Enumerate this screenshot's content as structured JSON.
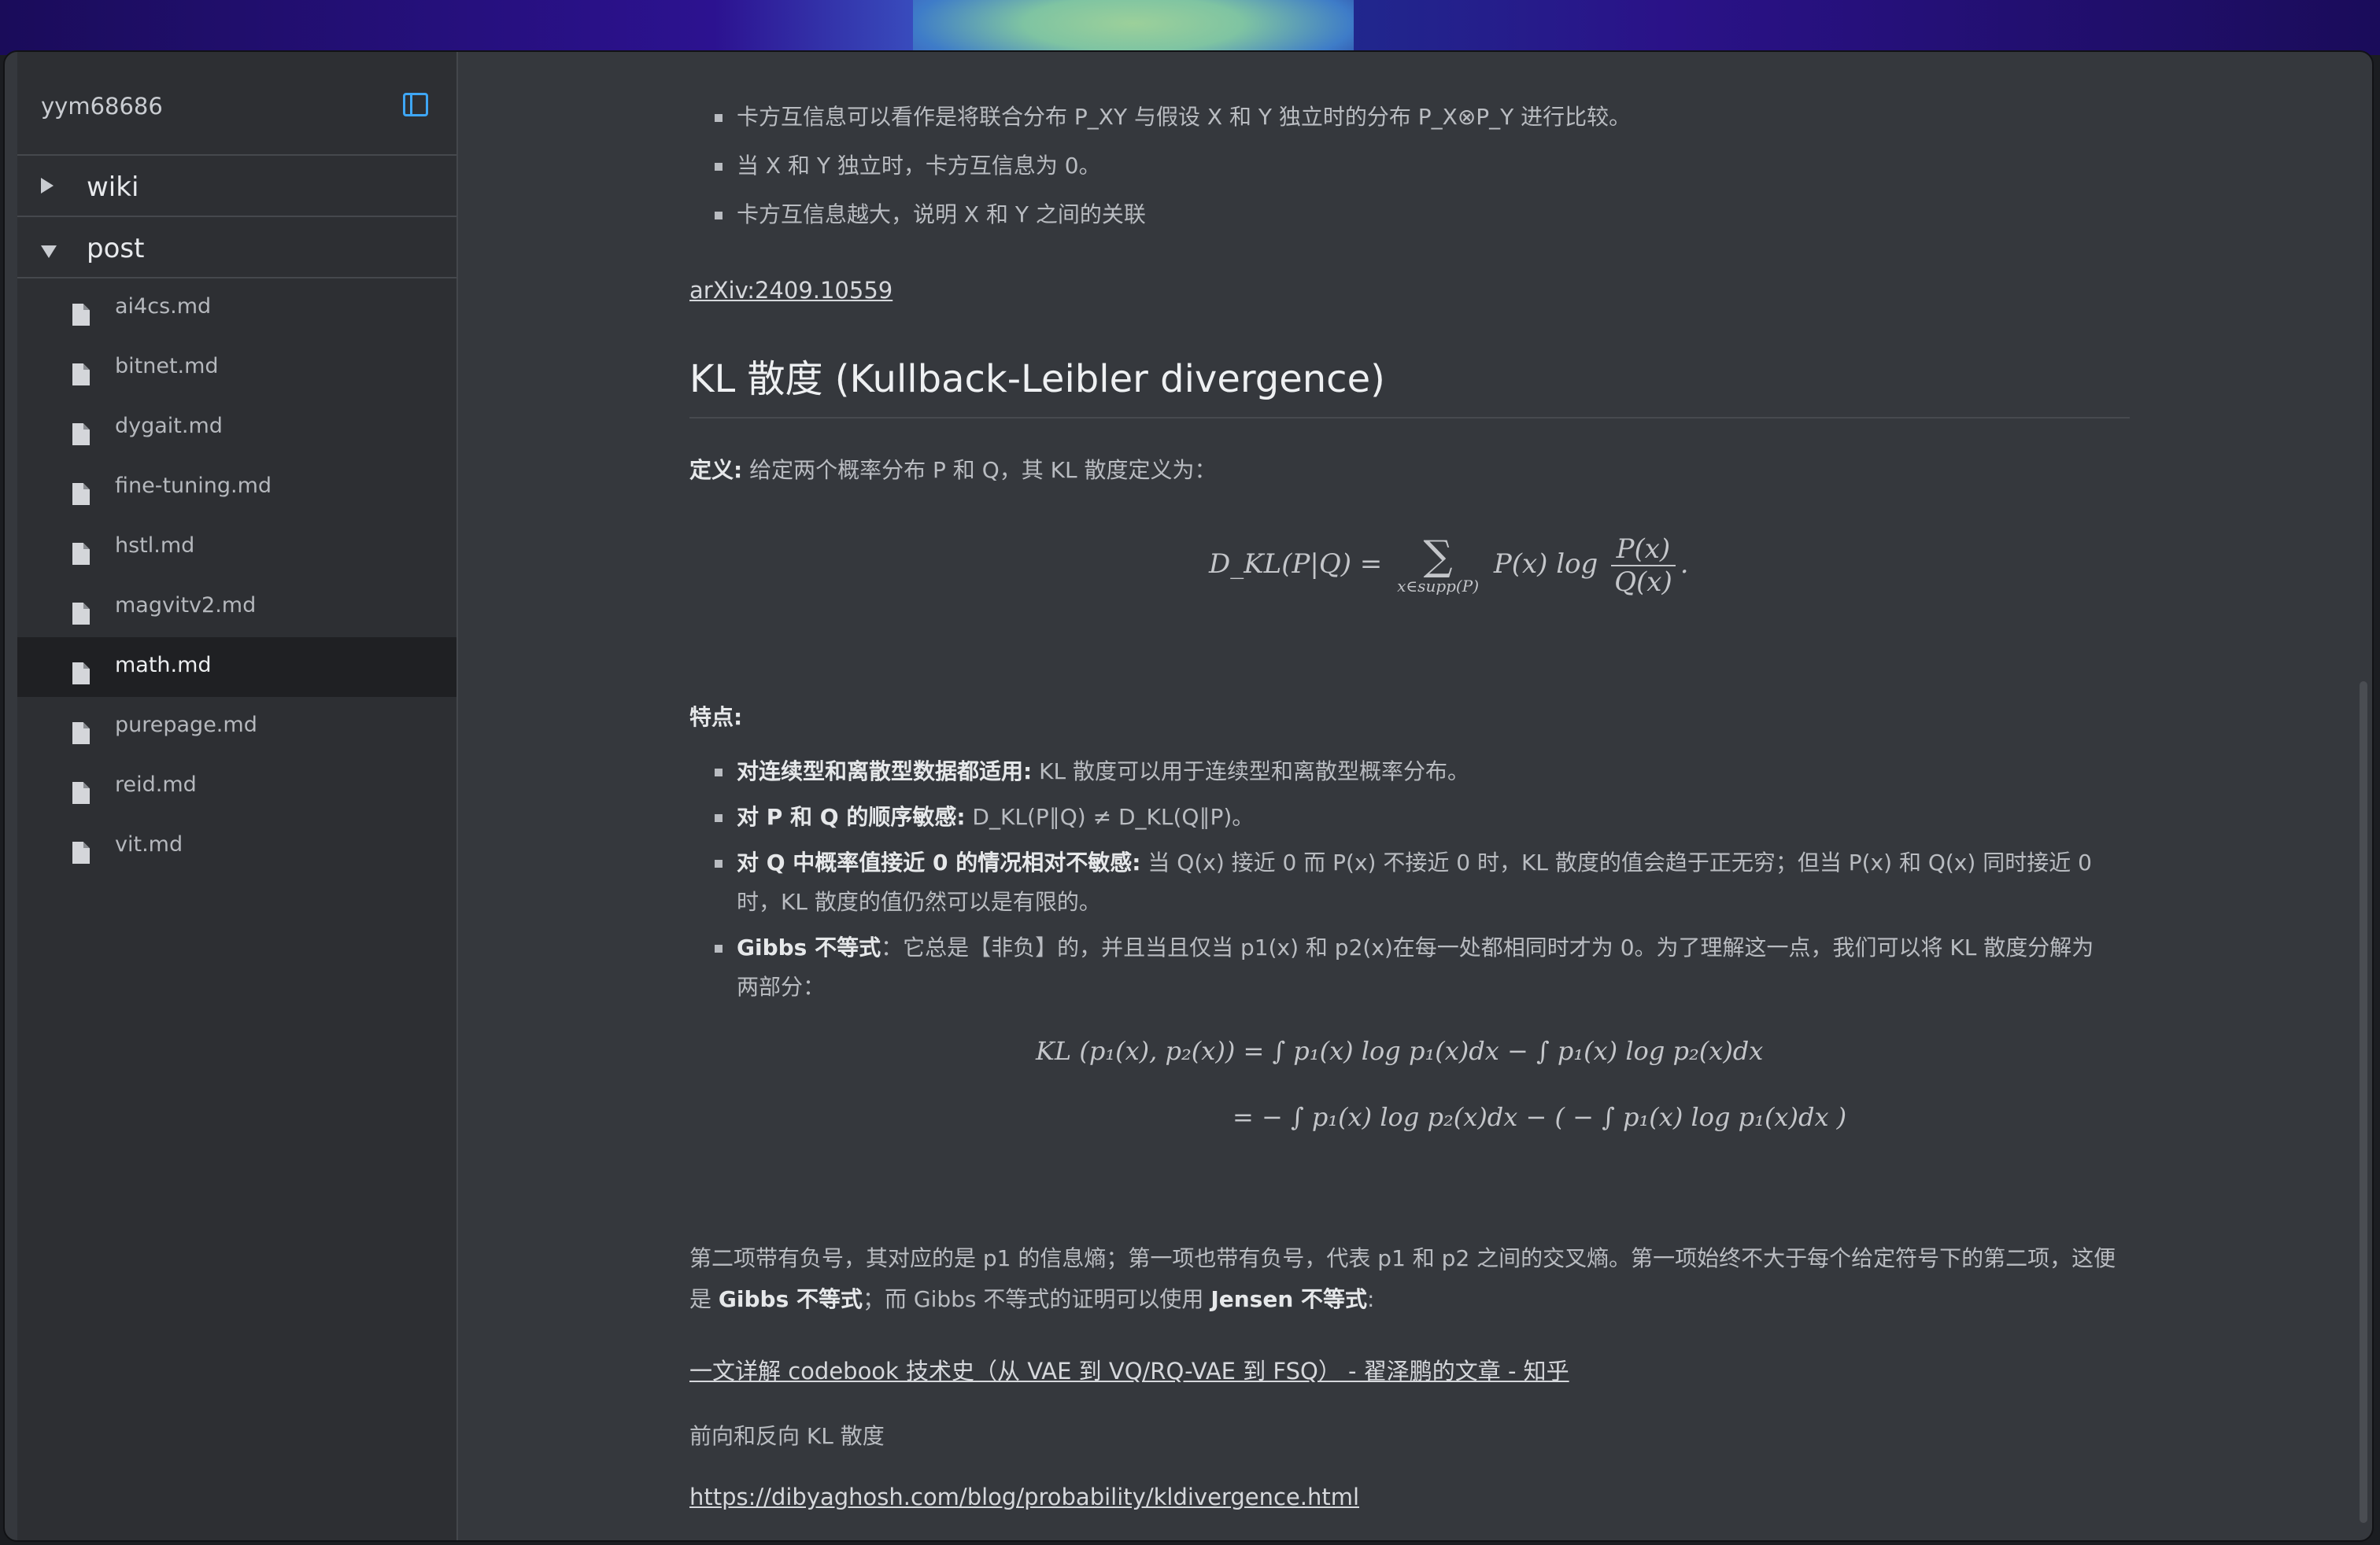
{
  "sidebar": {
    "title": "yym68686",
    "folders": [
      {
        "label": "wiki",
        "expanded": false
      },
      {
        "label": "post",
        "expanded": true
      }
    ],
    "files": [
      "ai4cs.md",
      "bitnet.md",
      "dygait.md",
      "fine-tuning.md",
      "hstl.md",
      "magvitv2.md",
      "math.md",
      "purepage.md",
      "reid.md",
      "vit.md"
    ],
    "active_file": "math.md"
  },
  "article": {
    "top_bullets": [
      "卡方互信息可以看作是将联合分布 P_XY 与假设 X 和 Y 独立时的分布 P_X⊗P_Y 进行比较。",
      "当 X 和 Y 独立时，卡方互信息为 0。",
      "卡方互信息越大，说明 X 和 Y 之间的关联"
    ],
    "arxiv_link": "arXiv:2409.10559",
    "heading": "KL 散度 (Kullback-Leibler divergence)",
    "definition_label": "定义:",
    "definition_text": " 给定两个概率分布 P 和 Q，其 KL 散度定义为：",
    "eq1": {
      "lhs": "D_KL(P|Q) =",
      "sum_under": "x∈supp(P)",
      "term": "P(x) log",
      "num": "P(x)",
      "den": "Q(x)",
      "tail": "."
    },
    "features_label": "特点:",
    "features": [
      {
        "bold": "对连续型和离散型数据都适用:",
        "text": " KL 散度可以用于连续型和离散型概率分布。"
      },
      {
        "bold": "对 P 和 Q 的顺序敏感:",
        "text": " D_KL(P∥Q) ≠ D_KL(Q∥P)。"
      },
      {
        "bold": "对 Q 中概率值接近 0 的情况相对不敏感:",
        "text": " 当 Q(x) 接近 0 而 P(x) 不接近 0 时，KL 散度的值会趋于正无穷；但当 P(x) 和 Q(x) 同时接近 0 时，KL 散度的值仍然可以是有限的。"
      },
      {
        "bold": "Gibbs 不等式",
        "text": "：它总是【非负】的，并且当且仅当 p1(x) 和 p2(x)在每一处都相同时才为 0。为了理解这一点，我们可以将 KL 散度分解为两部分："
      }
    ],
    "eq2_line1": "KL (p₁(x), p₂(x)) = ∫ p₁(x) log p₁(x)dx − ∫ p₁(x) log p₂(x)dx",
    "eq2_line2": "= − ∫ p₁(x) log p₂(x)dx − ( − ∫ p₁(x) log p₁(x)dx )",
    "para1_a": "第二项带有负号，其对应的是 p1 的信息熵；第一项也带有负号，代表 p1 和 p2 之间的交叉熵。第一项始终不大于每个给定符号下的第二项，这便是 ",
    "para1_b1": "Gibbs 不等式",
    "para1_c": "；而 Gibbs 不等式的证明可以使用 ",
    "para1_b2": "Jensen 不等式",
    "para1_d": ":",
    "zhihu_link": "一文详解 codebook 技术史（从 VAE 到 VQ/RQ-VAE 到 FSQ） - 翟泽鹏的文章 - 知乎",
    "forward_reverse": "前向和反向 KL 散度",
    "blog_link": "https://dibyaghosh.com/blog/probability/kldivergence.html"
  }
}
